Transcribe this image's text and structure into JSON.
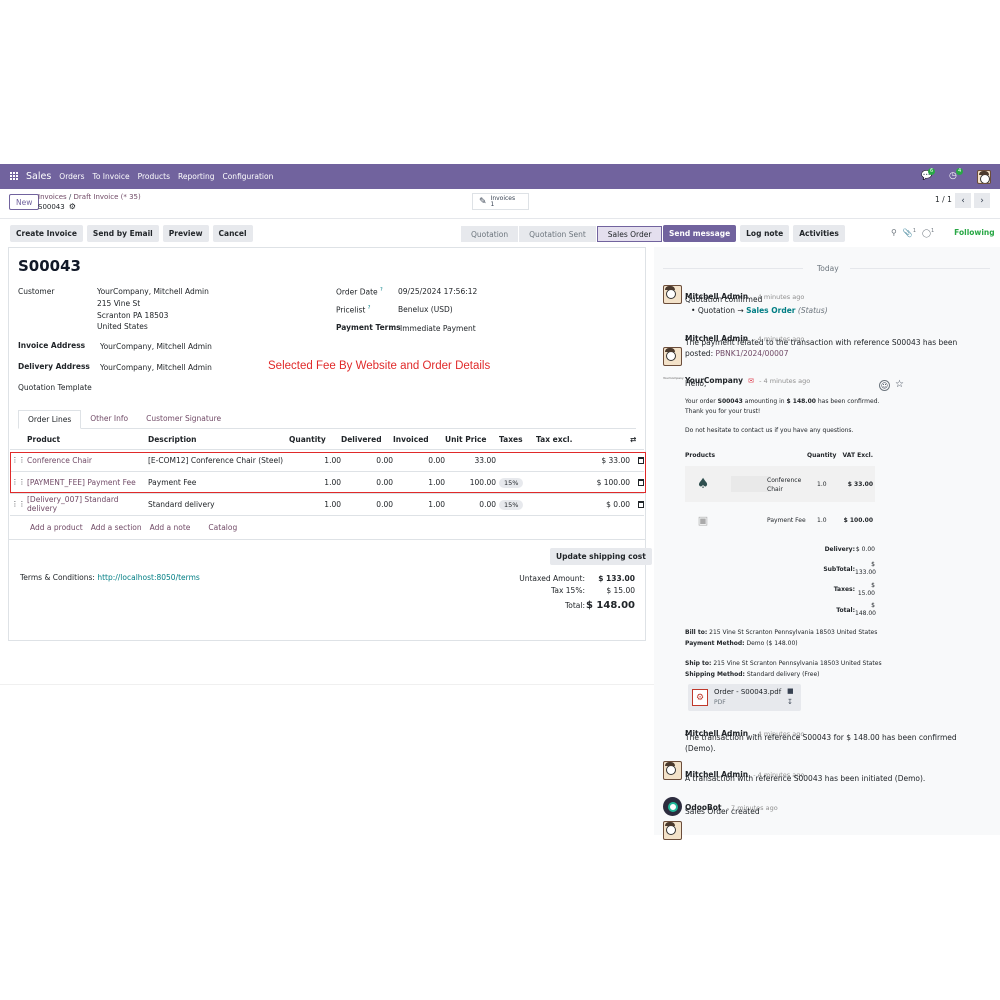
{
  "navbar": {
    "app_name": "Sales",
    "menus": [
      "Orders",
      "To Invoice",
      "Products",
      "Reporting",
      "Configuration"
    ],
    "chat_count": "6",
    "activity_count": "4"
  },
  "control": {
    "new_label": "New",
    "breadcrumb_parent": "Invoices",
    "breadcrumb_sep": "/",
    "breadcrumb_current": "Draft Invoice (* 35)",
    "record_name": "S00043",
    "smart_button_label": "Invoices",
    "smart_button_count": "1",
    "pager": "1 / 1"
  },
  "actions": {
    "create_invoice": "Create Invoice",
    "send_by_email": "Send by Email",
    "preview": "Preview",
    "cancel": "Cancel"
  },
  "status": [
    "Quotation",
    "Quotation Sent",
    "Sales Order"
  ],
  "form": {
    "title": "S00043",
    "customer_label": "Customer",
    "customer_name": "YourCompany, Mitchell Admin",
    "customer_addr1": "215 Vine St",
    "customer_addr2": "Scranton PA 18503",
    "customer_addr3": "United States",
    "invoice_address_label": "Invoice Address",
    "invoice_address": "YourCompany, Mitchell Admin",
    "delivery_address_label": "Delivery Address",
    "delivery_address": "YourCompany, Mitchell Admin",
    "quotation_template_label": "Quotation Template",
    "order_date_label": "Order Date",
    "order_date": "09/25/2024 17:56:12",
    "pricelist_label": "Pricelist",
    "pricelist": "Benelux (USD)",
    "payment_terms_label": "Payment Terms",
    "payment_terms": "Immediate Payment",
    "help_mark": "?"
  },
  "annotation": "Selected Fee By Website and Order Details",
  "tabs": [
    "Order Lines",
    "Other Info",
    "Customer Signature"
  ],
  "lines": {
    "headers": [
      "Product",
      "Description",
      "Quantity",
      "Delivered",
      "Invoiced",
      "Unit Price",
      "Taxes",
      "Tax excl."
    ],
    "rows": [
      {
        "product": "Conference Chair",
        "description": "[E-COM12] Conference Chair (Steel)",
        "quantity": "1.00",
        "delivered": "0.00",
        "invoiced": "0.00",
        "unit_price": "33.00",
        "taxes": "",
        "subtotal": "$ 33.00"
      },
      {
        "product": "[PAYMENT_FEE] Payment Fee",
        "description": "Payment Fee",
        "quantity": "1.00",
        "delivered": "0.00",
        "invoiced": "1.00",
        "unit_price": "100.00",
        "taxes": "15%",
        "subtotal": "$ 100.00"
      },
      {
        "product": "[Delivery_007] Standard delivery",
        "description": "Standard delivery",
        "quantity": "1.00",
        "delivered": "0.00",
        "invoiced": "1.00",
        "unit_price": "0.00",
        "taxes": "15%",
        "subtotal": "$ 0.00"
      }
    ],
    "add_links": [
      "Add a product",
      "Add a section",
      "Add a note",
      "Catalog"
    ]
  },
  "totals": {
    "update_shipping": "Update shipping cost",
    "terms_label": "Terms & Conditions:",
    "terms_link": "http://localhost:8050/terms",
    "untaxed_label": "Untaxed Amount:",
    "untaxed": "$ 133.00",
    "tax_label": "Tax 15%:",
    "tax": "$ 15.00",
    "total_label": "Total:",
    "total": "$ 148.00"
  },
  "chatter": {
    "send_message": "Send message",
    "log_note": "Log note",
    "activities": "Activities",
    "attachments_count": "1",
    "followers_count": "1",
    "following": "Following",
    "today": "Today",
    "m1_author": "Mitchell Admin",
    "m1_time": "- 4 minutes ago",
    "m1_body": "Quotation confirmed",
    "m1_bullet": "Quotation",
    "m1_arrow": "→",
    "m1_new": "Sales Order",
    "m1_field": "(Status)",
    "m2_author": "Mitchell Admin",
    "m2_time": "- 4 minutes ago",
    "m2_body": "The payment related to the transaction with reference S00043 has been",
    "m2_body2": "posted:",
    "m2_link": "PBNK1/2024/00007",
    "m3_author": "YourCompany",
    "m3_time": "- 4 minutes ago",
    "m3_logo_text": "YourCompany",
    "m3_hello": "Hello,",
    "m3_line1_a": "Your order",
    "m3_line1_b": "S00043",
    "m3_line1_c": "amounting in",
    "m3_line1_d": "$ 148.00",
    "m3_line1_e": "has been confirmed.",
    "m3_line2": "Thank you for your trust!",
    "m3_line3": "Do not hesitate to contact us if you have any questions.",
    "mail_headers": [
      "Products",
      "Quantity",
      "VAT Excl."
    ],
    "mail_rows": [
      {
        "name": "Conference Chair",
        "qty": "1.0",
        "price": "$ 33.00"
      },
      {
        "name": "Payment Fee",
        "qty": "1.0",
        "price": "$ 100.00"
      }
    ],
    "mail_totals": [
      {
        "label": "Delivery:",
        "value": "$ 0.00"
      },
      {
        "label": "SubTotal:",
        "value": "$ 133.00"
      },
      {
        "label": "Taxes:",
        "value": "$ 15.00"
      },
      {
        "label": "Total:",
        "value": "$ 148.00"
      }
    ],
    "bill_to_label": "Bill to:",
    "bill_to": "215 Vine St Scranton Pennsylvania 18503 United States",
    "payment_method_label": "Payment Method:",
    "payment_method": "Demo ($ 148.00)",
    "ship_to_label": "Ship to:",
    "ship_to": "215 Vine St Scranton Pennsylvania 18503 United States",
    "shipping_method_label": "Shipping Method:",
    "shipping_method": "Standard delivery (Free)",
    "attachment_name": "Order - S00043.pdf",
    "attachment_type": "PDF",
    "m4_author": "Mitchell Admin",
    "m4_time": "- 4 minutes ago",
    "m4_body": "The transaction with reference S00043 for $ 148.00 has been confirmed",
    "m4_body2": "(Demo).",
    "m5_author": "Mitchell Admin",
    "m5_time": "- 4 minutes ago",
    "m5_body": "A transaction with reference S00043 has been initiated (Demo).",
    "m6_author": "OdooBot",
    "m6_time": "- 7 minutes ago",
    "m6_body": "Sales Order created"
  },
  "colors": {
    "brand": "#71639e",
    "link": "#017e84",
    "highlight": "#e02a2a",
    "following": "#28a745"
  }
}
